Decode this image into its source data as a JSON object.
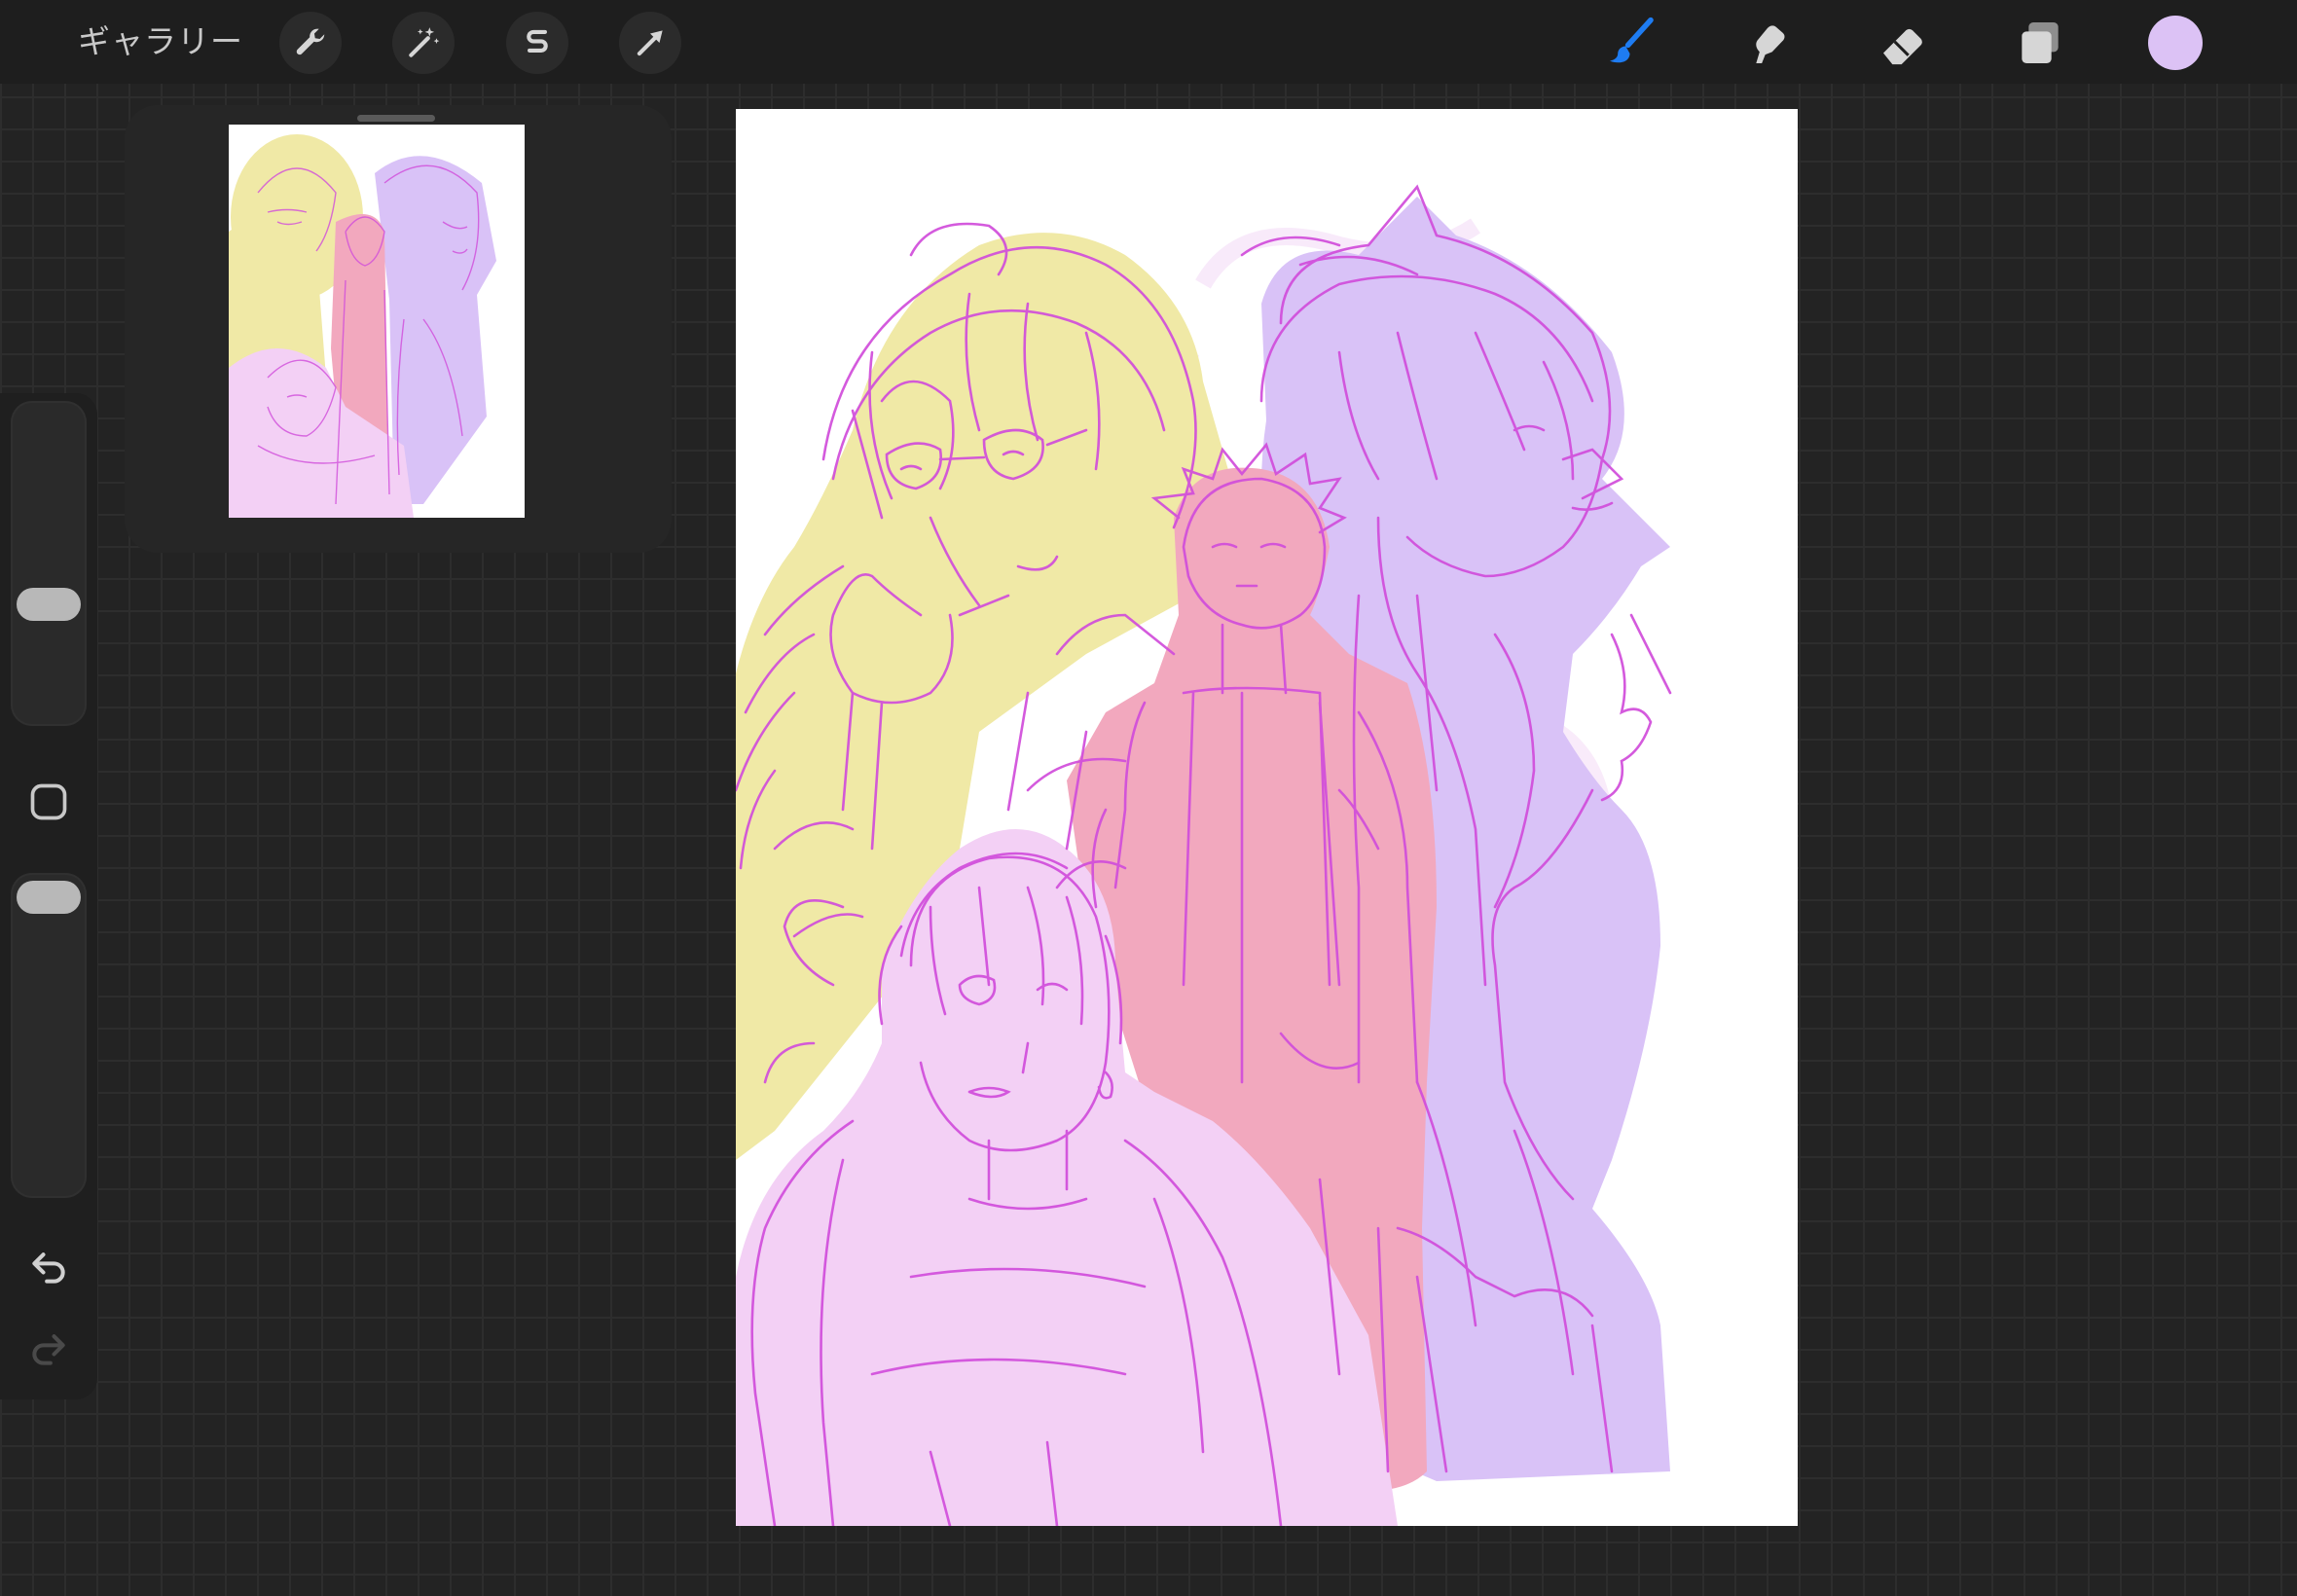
{
  "topbar": {
    "gallery_label": "ギャラリー",
    "tools_left": [
      {
        "name": "actions",
        "icon": "wrench-icon"
      },
      {
        "name": "adjustments",
        "icon": "magic-wand-icon"
      },
      {
        "name": "selection",
        "icon": "selection-s-icon"
      },
      {
        "name": "transform",
        "icon": "arrow-cursor-icon"
      }
    ],
    "tools_right": [
      {
        "name": "brush",
        "icon": "brush-icon",
        "active": true
      },
      {
        "name": "smudge",
        "icon": "smudge-finger-icon"
      },
      {
        "name": "eraser",
        "icon": "eraser-icon"
      },
      {
        "name": "layers",
        "icon": "layers-icon"
      }
    ],
    "current_color": "#dcc2f5",
    "active_color": "#1e7cf2"
  },
  "sidebar": {
    "brush_size_level": 0.62,
    "opacity_level": 0.95,
    "modify_icon": "square-outline-icon",
    "undo_icon": "undo-icon",
    "redo_icon": "redo-icon"
  },
  "reference": {
    "handle_icon": "drag-handle-icon"
  },
  "canvas": {
    "palette": {
      "yellow": "#f0e9a6",
      "pink": "#f2a8be",
      "light_purple": "#f3d0f5",
      "lavender": "#d9c2f7",
      "line": "#d14ddb"
    }
  }
}
